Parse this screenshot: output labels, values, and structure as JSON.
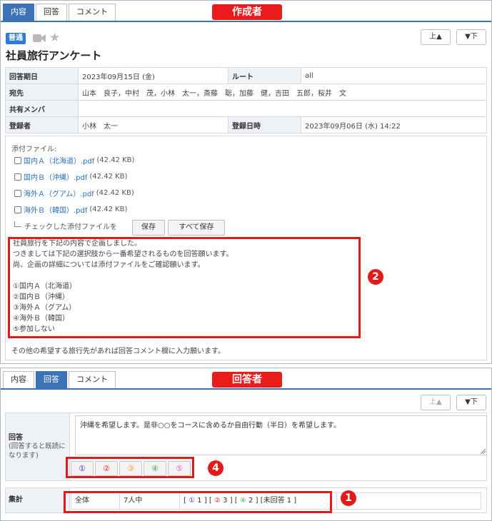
{
  "colors": {
    "accent": "#3b72b8",
    "annotation_red": "#e31a1a",
    "choice_1": "#2b3fd6",
    "choice_2": "#e0282c",
    "choice_3": "#f0a33a",
    "choice_4": "#36a34a",
    "choice_5": "#dc64e6"
  },
  "creator_view": {
    "tabs": [
      {
        "label": "内容",
        "active": true
      },
      {
        "label": "回答",
        "active": false
      },
      {
        "label": "コメント",
        "active": false
      }
    ],
    "role_badge": "作成者",
    "nav": {
      "up": "上▲",
      "down": "▼下"
    },
    "priority_badge": "普通",
    "icons": [
      "video-camera-icon",
      "star-icon"
    ],
    "title": "社員旅行アンケート",
    "info": {
      "deadline_label": "回答期日",
      "deadline_value": "2023年09月15日 (金)",
      "route_label": "ルート",
      "route_value": "all",
      "recipients_label": "宛先",
      "recipients_value": "山本　良子，中村　茂，小林　太一，斎藤　聡，加藤　健，吉田　五郎，桜井　文",
      "shared_label": "共有メンバ",
      "shared_value": "",
      "registrant_label": "登録者",
      "registrant_value": "小林　太一",
      "registered_at_label": "登録日時",
      "registered_at_value": "2023年09月06日 (水) 14:22"
    },
    "attachments_heading": "添付ファイル:",
    "files": [
      {
        "name": "国内Ａ（北海道）.pdf",
        "size": "(42.42 KB)"
      },
      {
        "name": "国内Ｂ（沖縄）.pdf",
        "size": "(42.42 KB)"
      },
      {
        "name": "海外Ａ（グアム）.pdf",
        "size": "(42.42 KB)"
      },
      {
        "name": "海外Ｂ（韓国）.pdf",
        "size": "(42.42 KB)"
      }
    ],
    "save_note": "チェックした添付ファイルを",
    "save_button": "保存",
    "save_all_button": "すべて保存",
    "message_lines": [
      "社員旅行を下記の内容で企画しました。",
      "つきましては下記の選択肢から一番希望されるものを回答願います。",
      "尚、企画の詳細については添付ファイルをご確認願います。",
      "",
      "①国内Ａ（北海道）",
      "②国内Ｂ（沖縄）",
      "③海外Ａ（グアム）",
      "④海外Ｂ（韓国）",
      "⑤参加しない"
    ],
    "closing_note": "その他の希望する旅行先があれば回答コメント欄に入力願います。",
    "marker": "2"
  },
  "responder_view": {
    "tabs": [
      {
        "label": "内容",
        "active": false
      },
      {
        "label": "回答",
        "active": true
      },
      {
        "label": "コメント",
        "active": false
      }
    ],
    "role_badge": "回答者",
    "nav": {
      "up": "上▲",
      "down": "▼下"
    },
    "answer_label": "回答",
    "answer_hint": "(回答すると既読になります)",
    "answer_text": "沖縄を希望します。是非○○をコースに含めるか自由行動（半日）を希望します。",
    "choices": [
      "①",
      "②",
      "③",
      "④",
      "⑤"
    ],
    "choices_marker": "4",
    "tally_label": "集計",
    "tally_scope": "全体",
    "tally_count": "7人中",
    "tally_result": {
      "open": "[",
      "c1": "①",
      "v1": "1",
      "mid1": "] [",
      "c2": "②",
      "v2": "3",
      "mid2": "] [",
      "c4": "④",
      "v4": "2",
      "tail": "] [未回答 1 ]"
    },
    "tally_marker": "1"
  }
}
